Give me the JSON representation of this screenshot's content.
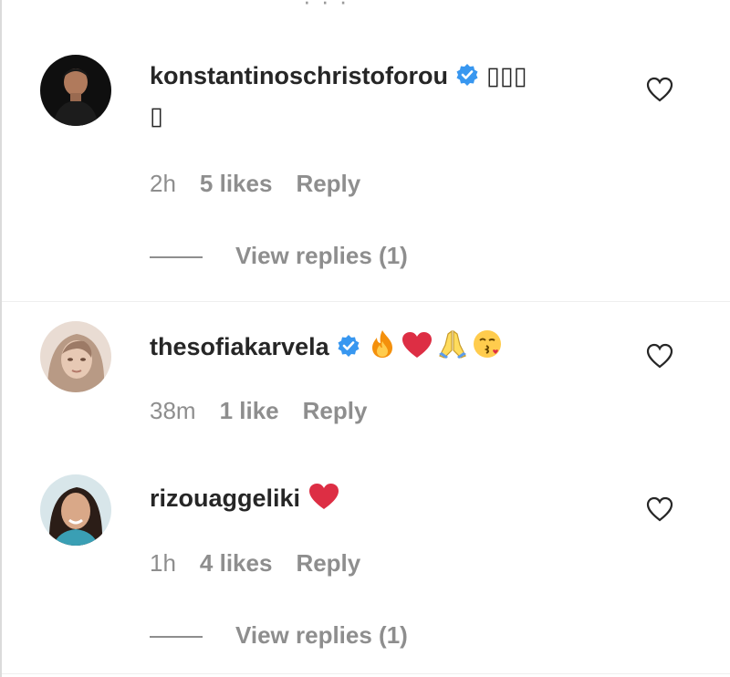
{
  "partial_top_text": "· · ·",
  "comments": [
    {
      "username": "konstantinoschristoforou",
      "verified": true,
      "text": "▯▯▯",
      "text_cont": "▯",
      "time": "2h",
      "likes": "5 likes",
      "reply": "Reply",
      "view_replies": "View replies (1)",
      "avatar_icon": "man-portrait-avatar"
    },
    {
      "username": "thesofiakarvela",
      "verified": true,
      "emojis": [
        "fire-emoji",
        "red-heart-emoji",
        "folded-hands-emoji",
        "face-blowing-kiss-emoji"
      ],
      "time": "38m",
      "likes": "1 like",
      "reply": "Reply",
      "avatar_icon": "woman-portrait-avatar"
    },
    {
      "username": "rizouaggeliki",
      "verified": false,
      "emojis": [
        "red-heart-emoji"
      ],
      "time": "1h",
      "likes": "4 likes",
      "reply": "Reply",
      "view_replies": "View replies (1)",
      "avatar_icon": "woman-smiling-avatar"
    }
  ],
  "colors": {
    "username": "#262626",
    "meta": "#8e8e8e",
    "verified_badge": "#3897f0",
    "heart_outline": "#262626"
  }
}
